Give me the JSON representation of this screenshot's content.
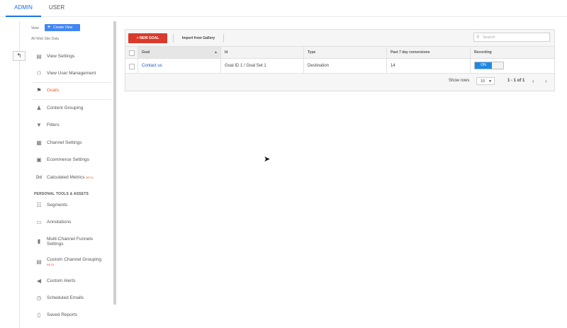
{
  "tabs": {
    "admin": "ADMIN",
    "user": "USER"
  },
  "view": {
    "label": "View",
    "create_button": "Create View",
    "subtitle": "All Web Site Data"
  },
  "sidebar": {
    "items": [
      {
        "label": "View Settings",
        "icon": "page-icon"
      },
      {
        "label": "View User Management",
        "icon": "people-icon"
      },
      {
        "label": "Goals",
        "icon": "flag-icon",
        "active": true
      },
      {
        "label": "Content Grouping",
        "icon": "person-icon"
      },
      {
        "label": "Filters",
        "icon": "funnel-icon"
      },
      {
        "label": "Channel Settings",
        "icon": "channel-icon"
      },
      {
        "label": "Ecommerce Settings",
        "icon": "cart-icon"
      },
      {
        "label": "Calculated Metrics",
        "icon": "dd-icon",
        "badge": "BETA"
      }
    ],
    "section_heading": "PERSONAL TOOLS & ASSETS",
    "personal_items": [
      {
        "label": "Segments",
        "icon": "segments-icon"
      },
      {
        "label": "Annotations",
        "icon": "comment-icon"
      },
      {
        "label_line1": "Multi-Channel Funnels",
        "label_line2": "Settings",
        "icon": "bars-icon"
      },
      {
        "label": "Custom Channel Grouping",
        "badge": "BETA",
        "icon": "grouping-icon"
      },
      {
        "label": "Custom Alerts",
        "icon": "megaphone-icon"
      },
      {
        "label": "Scheduled Emails",
        "icon": "clock-icon"
      },
      {
        "label": "Saved Reports",
        "icon": "report-icon"
      }
    ]
  },
  "toolbar": {
    "new_goal": "+ NEW GOAL",
    "import": "Import from Gallery",
    "search_placeholder": "Search"
  },
  "table": {
    "columns": [
      "Goal",
      "Id",
      "Type",
      "Past 7 day conversions",
      "Recording"
    ],
    "rows": [
      {
        "goal": "Contact us",
        "id": "Goal ID 1 / Goal Set 1",
        "type": "Destination",
        "conversions": "14",
        "recording": "ON"
      }
    ]
  },
  "footer": {
    "show_rows_label": "Show rows",
    "rows_value": "10",
    "range": "1 - 1 of 1"
  },
  "colors": {
    "accent": "#1a73e8",
    "new_goal": "#d93a2b",
    "active": "#e45c2a",
    "toggle_on": "#1e88e5"
  }
}
